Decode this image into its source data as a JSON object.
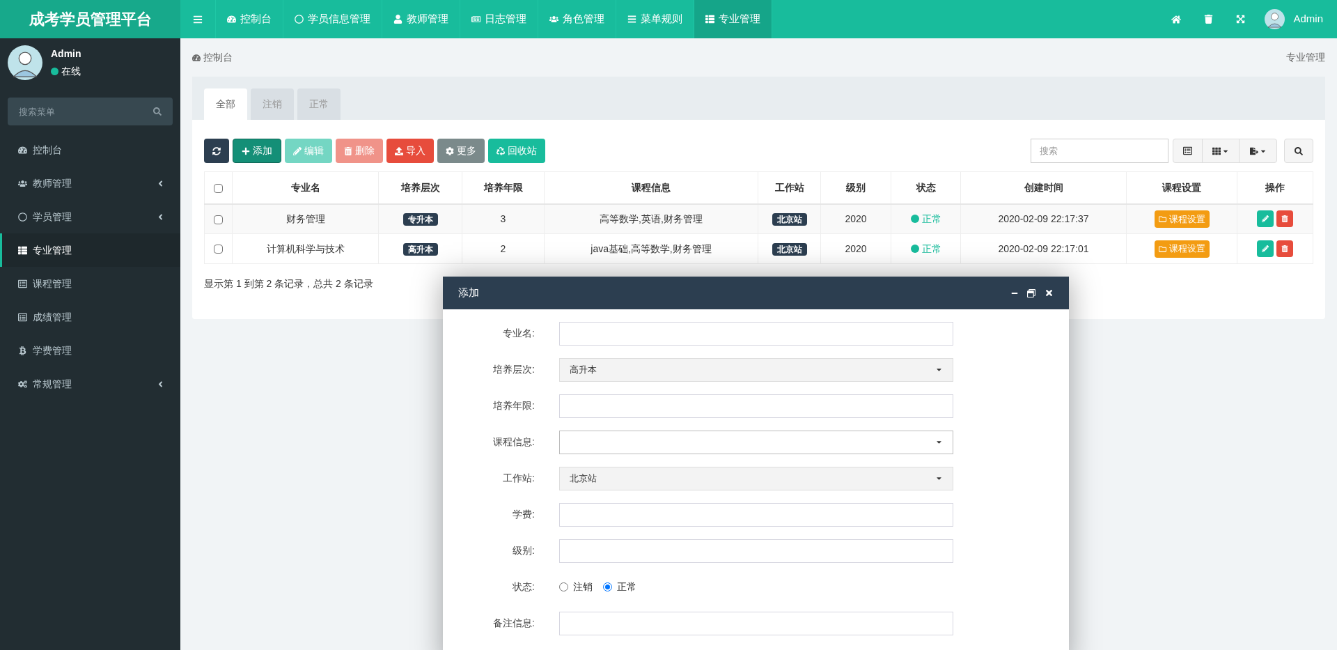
{
  "app_title": "成考学员管理平台",
  "top_nav": [
    {
      "label": "控制台",
      "selected": false
    },
    {
      "label": "学员信息管理",
      "selected": false
    },
    {
      "label": "教师管理",
      "selected": false
    },
    {
      "label": "日志管理",
      "selected": false
    },
    {
      "label": "角色管理",
      "selected": false
    },
    {
      "label": "菜单规则",
      "selected": false
    },
    {
      "label": "专业管理",
      "selected": true
    }
  ],
  "top_user": "Admin",
  "user_panel": {
    "name": "Admin",
    "status": "在线"
  },
  "sidebar_search": {
    "placeholder": "搜索菜单"
  },
  "sidebar": [
    {
      "label": "控制台",
      "selected": false,
      "submenu": false
    },
    {
      "label": "教师管理",
      "selected": false,
      "submenu": true
    },
    {
      "label": "学员管理",
      "selected": false,
      "submenu": true
    },
    {
      "label": "专业管理",
      "selected": true,
      "submenu": false
    },
    {
      "label": "课程管理",
      "selected": false,
      "submenu": false
    },
    {
      "label": "成绩管理",
      "selected": false,
      "submenu": false
    },
    {
      "label": "学费管理",
      "selected": false,
      "submenu": false
    },
    {
      "label": "常规管理",
      "selected": false,
      "submenu": true
    }
  ],
  "breadcrumb": "控制台",
  "page_title": "专业管理",
  "tabs": [
    {
      "label": "全部",
      "selected": true
    },
    {
      "label": "注销",
      "selected": false
    },
    {
      "label": "正常",
      "selected": false
    }
  ],
  "toolbar": [
    {
      "kind": "refresh",
      "disabled": false
    },
    {
      "kind": "add",
      "label": "添加",
      "disabled": false
    },
    {
      "kind": "edit",
      "label": "编辑",
      "disabled": true
    },
    {
      "kind": "delete",
      "label": "删除",
      "disabled": true
    },
    {
      "kind": "import",
      "label": "导入",
      "disabled": false
    },
    {
      "kind": "more",
      "label": "更多",
      "disabled": false
    },
    {
      "kind": "recycle",
      "label": "回收站",
      "disabled": false
    }
  ],
  "table_search": {
    "placeholder": "搜索"
  },
  "table": {
    "select_all_checked": false,
    "columns": [
      "专业名",
      "培养层次",
      "培养年限",
      "课程信息",
      "工作站",
      "级别",
      "状态",
      "创建时间",
      "课程设置",
      "操作"
    ],
    "rows": [
      {
        "checked": false,
        "name": "财务管理",
        "training_level": "专升本",
        "years": "3",
        "courses": "高等数学,英语,财务管理",
        "station": "北京站",
        "grade": "2020",
        "status": "正常",
        "color": "#18bc9c",
        "created": "2020-02-09 22:17:37",
        "course_setting": "课程设置"
      },
      {
        "checked": false,
        "name": "计算机科学与技术",
        "training_level": "高升本",
        "years": "2",
        "courses": "java基础,高等数学,财务管理",
        "station": "北京站",
        "grade": "2020",
        "status": "正常",
        "color": "#18bc9c",
        "created": "2020-02-09 22:17:01",
        "course_setting": "课程设置"
      }
    ]
  },
  "pagination_info": "显示第 1 到第 2 条记录，总共 2 条记录",
  "dialog": {
    "title": "添加",
    "fields": [
      {
        "kind": "text",
        "label": "专业名:"
      },
      {
        "kind": "select",
        "label": "培养层次:",
        "value": "高升本",
        "disabled": true
      },
      {
        "kind": "text",
        "label": "培养年限:"
      },
      {
        "kind": "select",
        "label": "课程信息:",
        "disabled": false
      },
      {
        "kind": "select",
        "label": "工作站:",
        "value": "北京站",
        "disabled": true
      },
      {
        "kind": "text",
        "label": "学费:"
      },
      {
        "kind": "text",
        "label": "级别:"
      },
      {
        "kind": "radio",
        "label": "状态:",
        "options": [
          {
            "label": "注销",
            "selected": false
          },
          {
            "label": "正常",
            "selected": true
          }
        ]
      },
      {
        "kind": "text",
        "label": "备注信息:"
      }
    ]
  }
}
